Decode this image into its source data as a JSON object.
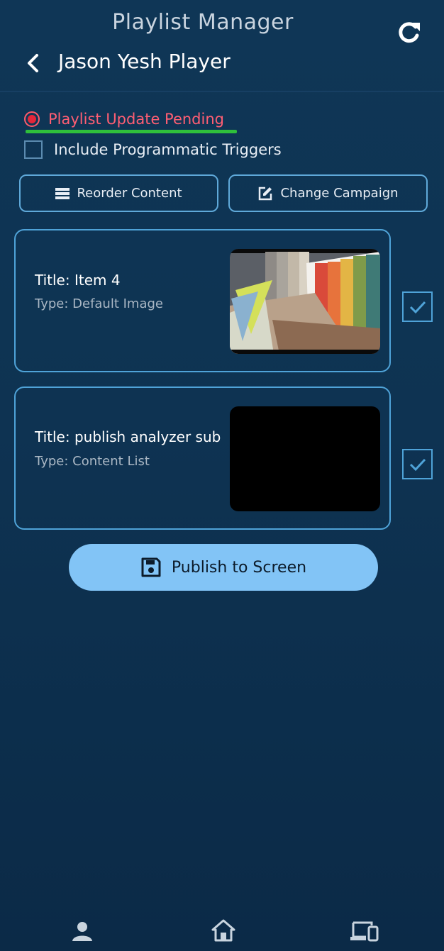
{
  "header": {
    "app_title": "Playlist Manager",
    "player_name": "Jason Yesh Player"
  },
  "status": {
    "pending_label": "Playlist Update Pending",
    "pending_color": "#ff5e73",
    "underline_color": "#2fbf3b"
  },
  "options": {
    "include_triggers_label": "Include Programmatic Triggers",
    "include_triggers_checked": false
  },
  "actions": {
    "reorder_label": "Reorder Content",
    "change_campaign_label": "Change Campaign",
    "publish_label": "Publish to Screen"
  },
  "items": [
    {
      "title": "Title: Item 4",
      "type": "Type: Default Image",
      "thumbnail": "color-swatch-image",
      "selected": true
    },
    {
      "title": "Title: publish analyzer sub",
      "type": "Type: Content List",
      "thumbnail": "blank-black",
      "selected": true
    }
  ],
  "nav": {
    "icons": [
      "user-icon",
      "home-icon",
      "devices-icon"
    ]
  },
  "colors": {
    "accent": "#4fa3d8",
    "publish_button": "#82c4f6",
    "background": "#0e3352"
  }
}
